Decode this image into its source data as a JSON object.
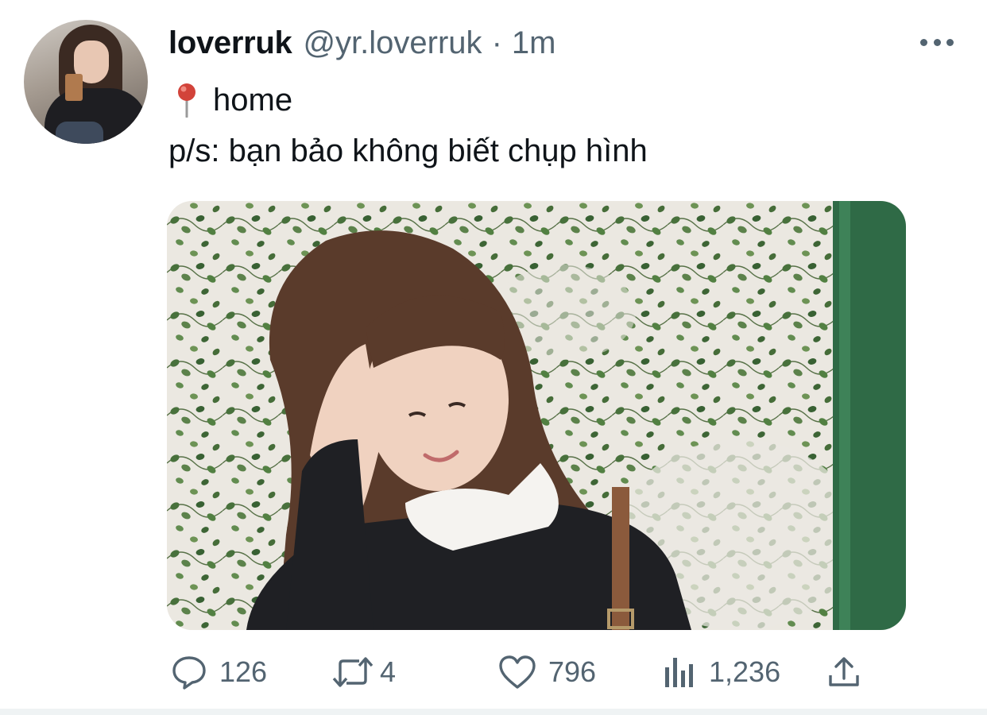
{
  "tweet": {
    "author": {
      "display_name": "loverruk",
      "handle": "@yr.loverruk",
      "avatar_icon": "profile-photo"
    },
    "separator": "·",
    "time": "1m",
    "location_emoji": "round-pushpin-icon",
    "location": "home",
    "text": "p/s: bạn bảo không biết chụp hình",
    "media": {
      "kind": "photo",
      "description_icon": "photo-girl-ivy-wall"
    },
    "stats": {
      "replies": "126",
      "retweets": "4",
      "likes": "796",
      "views": "1,236"
    }
  },
  "colors": {
    "text_primary": "#0f1419",
    "text_secondary": "#536471",
    "divider": "#eff3f4",
    "pin_red": "#d2433a"
  }
}
